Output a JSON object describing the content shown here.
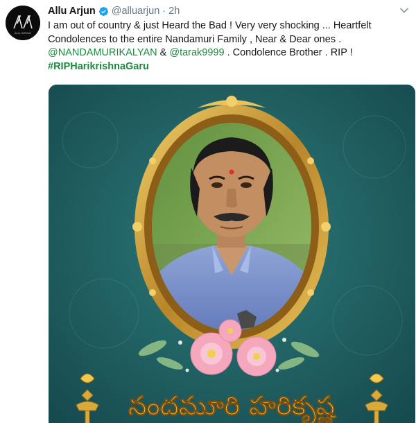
{
  "tweet": {
    "display_name": "Allu Arjun",
    "handle": "@alluarjun",
    "separator": "·",
    "time": "2h",
    "avatar_caption": "ALLU ARJUN",
    "text_line1": "I am out of country & just Heard the Bad ! Very very shocking ... Heartfelt",
    "text_line2": "Condolences to the entire Nandamuri Family , Near & Dear ones .",
    "mention1": "@NANDAMURIKALYAN",
    "amp": " & ",
    "mention2": "@tarak9999",
    "text_line3_rest": " . Condolence Brother . RIP !",
    "hashtag": "#RIPHarikrishnaGaru"
  },
  "media": {
    "telugu_name": "నందమూరి హరికృష్ణ"
  },
  "colors": {
    "link": "#1b8a3f",
    "verified": "#1da1f2",
    "muted": "#657786",
    "poster_bg": "#1f5a5c",
    "frame_gold": "#c8962e"
  },
  "icons": [
    "verified-badge-icon",
    "chevron-down-icon"
  ]
}
